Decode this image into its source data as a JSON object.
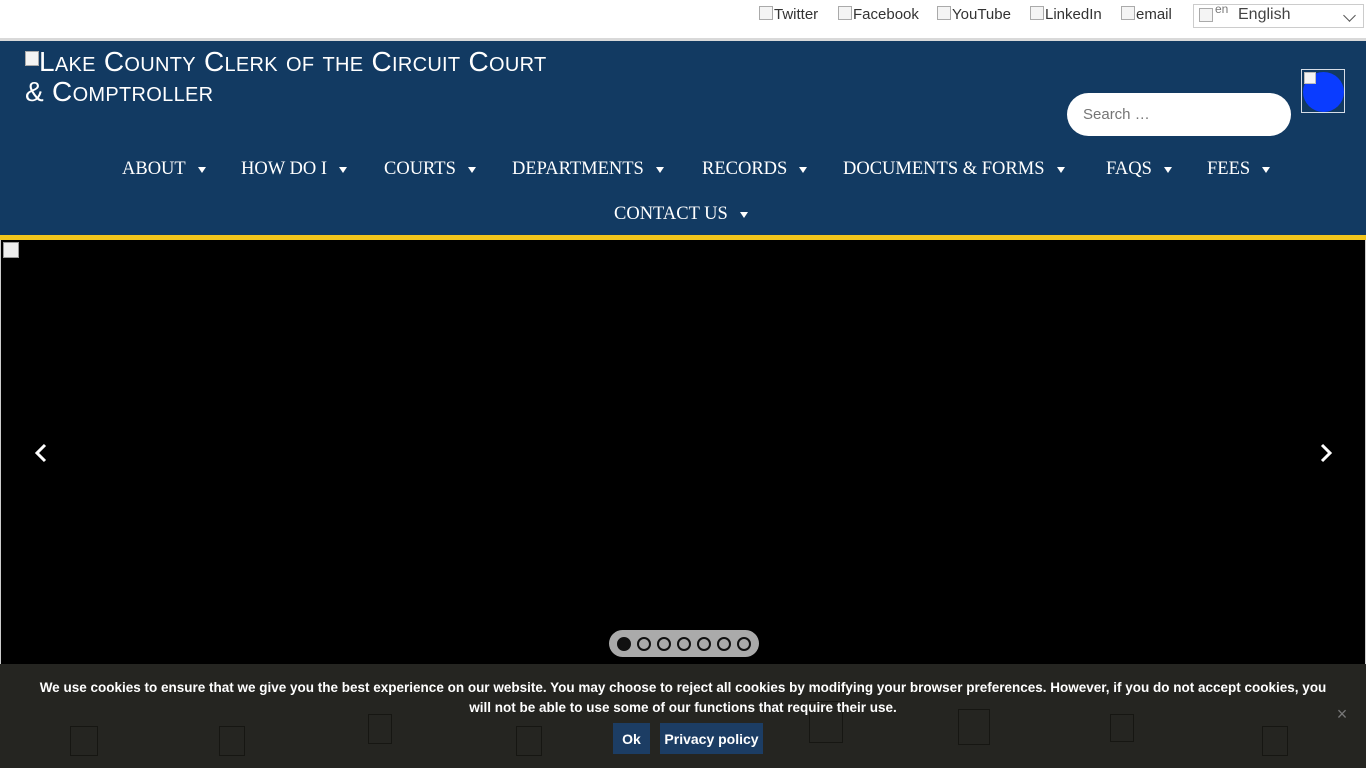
{
  "social": {
    "twitter": "Twitter",
    "facebook": "Facebook",
    "youtube": "YouTube",
    "linkedin": "LinkedIn",
    "email": "email"
  },
  "language": {
    "flag_alt": "en",
    "selected": "English"
  },
  "header": {
    "logo_text": "Lake County Clerk of the Circuit Court & Comptroller",
    "search_placeholder": "Search …"
  },
  "nav": {
    "items": [
      {
        "label": "About"
      },
      {
        "label": "How Do I"
      },
      {
        "label": "Courts"
      },
      {
        "label": "Departments"
      },
      {
        "label": "Records"
      },
      {
        "label": "Documents & Forms"
      },
      {
        "label": "FAQs"
      },
      {
        "label": "Fees"
      },
      {
        "label": "Contact Us"
      }
    ]
  },
  "slider": {
    "slide_count": 7,
    "active_index": 0
  },
  "cookie": {
    "message": "We use cookies to ensure that we give you the best experience on our website. You may choose to reject all cookies by modifying your browser preferences. However, if you do not accept cookies, you will not be able to use some of our functions that require their use.",
    "ok_label": "Ok",
    "privacy_label": "Privacy policy",
    "close_label": "×"
  },
  "colors": {
    "header_bg": "#123a62",
    "accent_gold": "#f2c51c",
    "a11y_blue": "#0a3cff",
    "cookie_button": "#1c3d64"
  }
}
